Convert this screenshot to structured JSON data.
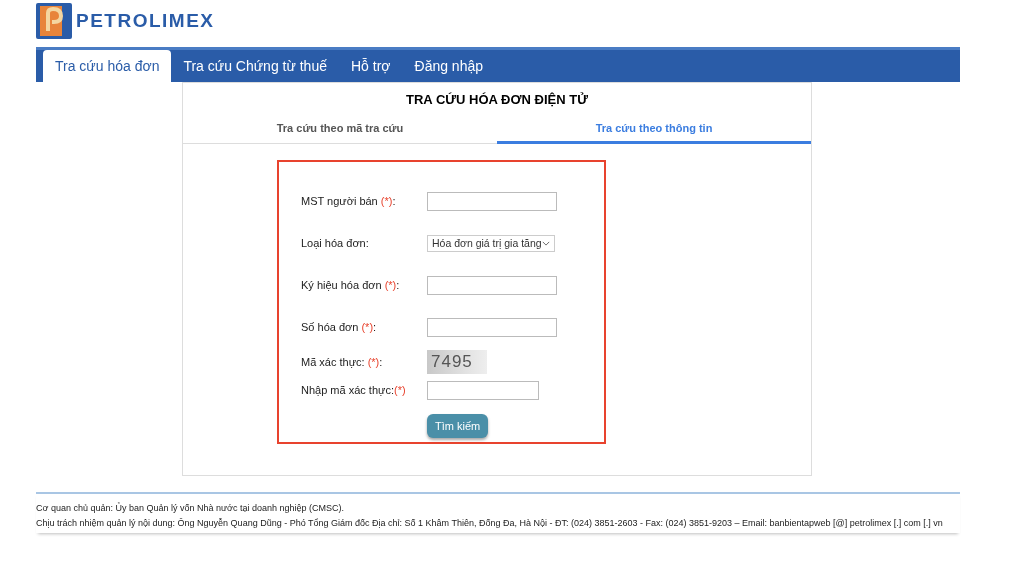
{
  "header": {
    "brand": "PETROLIMEX"
  },
  "nav": [
    {
      "label": "Tra cứu hóa đơn",
      "selected": true
    },
    {
      "label": "Tra cứu Chứng từ thuế",
      "selected": false
    },
    {
      "label": "Hỗ trợ",
      "selected": false
    },
    {
      "label": "Đăng nhập",
      "selected": false
    }
  ],
  "panel": {
    "title": "TRA CỨU HÓA ĐƠN ĐIỆN TỬ",
    "tabs": [
      {
        "label": "Tra cứu theo mã tra cứu",
        "selected": false
      },
      {
        "label": "Tra cứu theo thông tin",
        "selected": true
      }
    ],
    "fields": [
      {
        "kind": "text",
        "label": "MST người bán ",
        "required": "(*)",
        "suffix": ":"
      },
      {
        "kind": "select",
        "label": "Loại hóa đơn:",
        "value": "Hóa đơn giá trị gia tăng"
      },
      {
        "kind": "text",
        "label": "Ký hiệu hóa đơn ",
        "required": "(*)",
        "suffix": ":"
      },
      {
        "kind": "text",
        "label": "Số hóa đơn ",
        "required": "(*)",
        "suffix": ":"
      },
      {
        "kind": "captcha",
        "label": "Mã xác thực: ",
        "required": "(*)",
        "suffix": ":",
        "code": "7495"
      },
      {
        "kind": "short",
        "label": "Nhập mã xác thực:",
        "required": "(*)"
      }
    ],
    "button": "Tìm kiếm"
  },
  "footer": [
    "Cơ quan chủ quản: Ủy ban Quản lý vốn Nhà nước tại doanh nghiệp (CMSC).",
    "Chịu trách nhiệm quản lý nội dung: Ông Nguyễn Quang Dũng - Phó Tổng Giám đốc Địa chỉ: Số 1 Khâm Thiên, Đống Đa, Hà Nội - ĐT: (024) 3851-2603 - Fax: (024) 3851-9203 – Email: banbientapweb [@] petrolimex [.] com [.] vn"
  ]
}
